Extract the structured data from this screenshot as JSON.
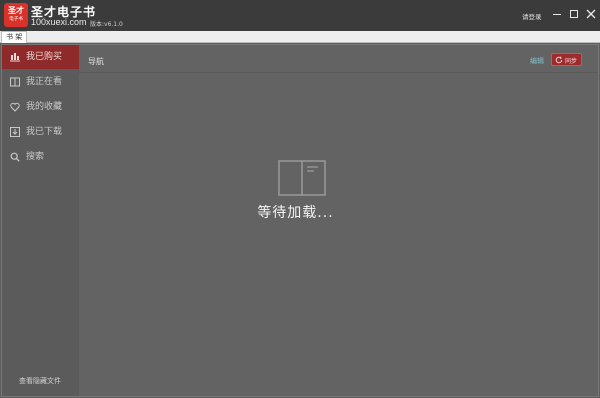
{
  "app": {
    "logo_line1": "圣才",
    "logo_line2": "电子书",
    "name": "圣才电子书",
    "url": "100xuexi.com",
    "version": "版本:v6.1.0",
    "login_label": "请登录"
  },
  "window_controls": {
    "minimize": "minimize-icon",
    "maximize": "maximize-icon",
    "close": "close-icon"
  },
  "tabs": [
    {
      "label": "书 架"
    }
  ],
  "sidebar": {
    "items": [
      {
        "label": "我已购买",
        "icon": "bar-chart-icon",
        "active": true
      },
      {
        "label": "我正在看",
        "icon": "open-book-icon",
        "active": false
      },
      {
        "label": "我的收藏",
        "icon": "heart-icon",
        "active": false
      },
      {
        "label": "我已下载",
        "icon": "download-icon",
        "active": false
      },
      {
        "label": "搜索",
        "icon": "search-icon",
        "active": false
      }
    ],
    "footer_link": "查看隐藏文件"
  },
  "main": {
    "title": "导航",
    "edit_label": "编辑",
    "sync_label": "同步",
    "loading_text": "等待加载..."
  },
  "colors": {
    "titlebar": "#3b3b3b",
    "accent": "#9e2b2b",
    "active_nav": "#8f2a2a",
    "logo": "#d9322a",
    "edit_link": "#7fc2c9",
    "content_bg": "#636363"
  }
}
